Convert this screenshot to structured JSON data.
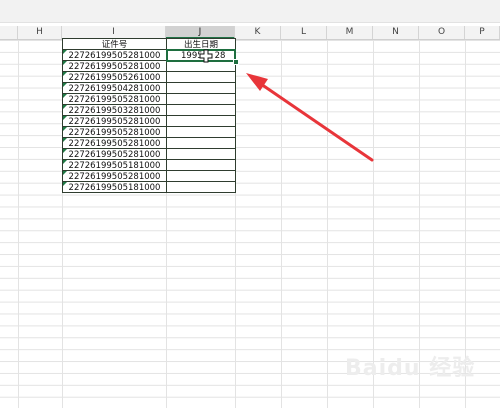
{
  "columns": [
    "H",
    "I",
    "J",
    "K",
    "L",
    "M",
    "N",
    "O",
    "P"
  ],
  "table": {
    "header_id": "证件号",
    "header_birth": "出生日期",
    "birth_value": "1995",
    "birth_value_tail": "28",
    "ids": [
      "22726199505281000",
      "22726199505281000",
      "22726199505261000",
      "22726199504281000",
      "22726199505281000",
      "22726199503281000",
      "22726199505281000",
      "22726199505281000",
      "22726199505281000",
      "22726199505281000",
      "22726199505181000",
      "22726199505281000",
      "22726199505181000"
    ]
  },
  "annotation": {
    "arrow_color": "#e8353a"
  },
  "watermark": "Baidu 经验"
}
